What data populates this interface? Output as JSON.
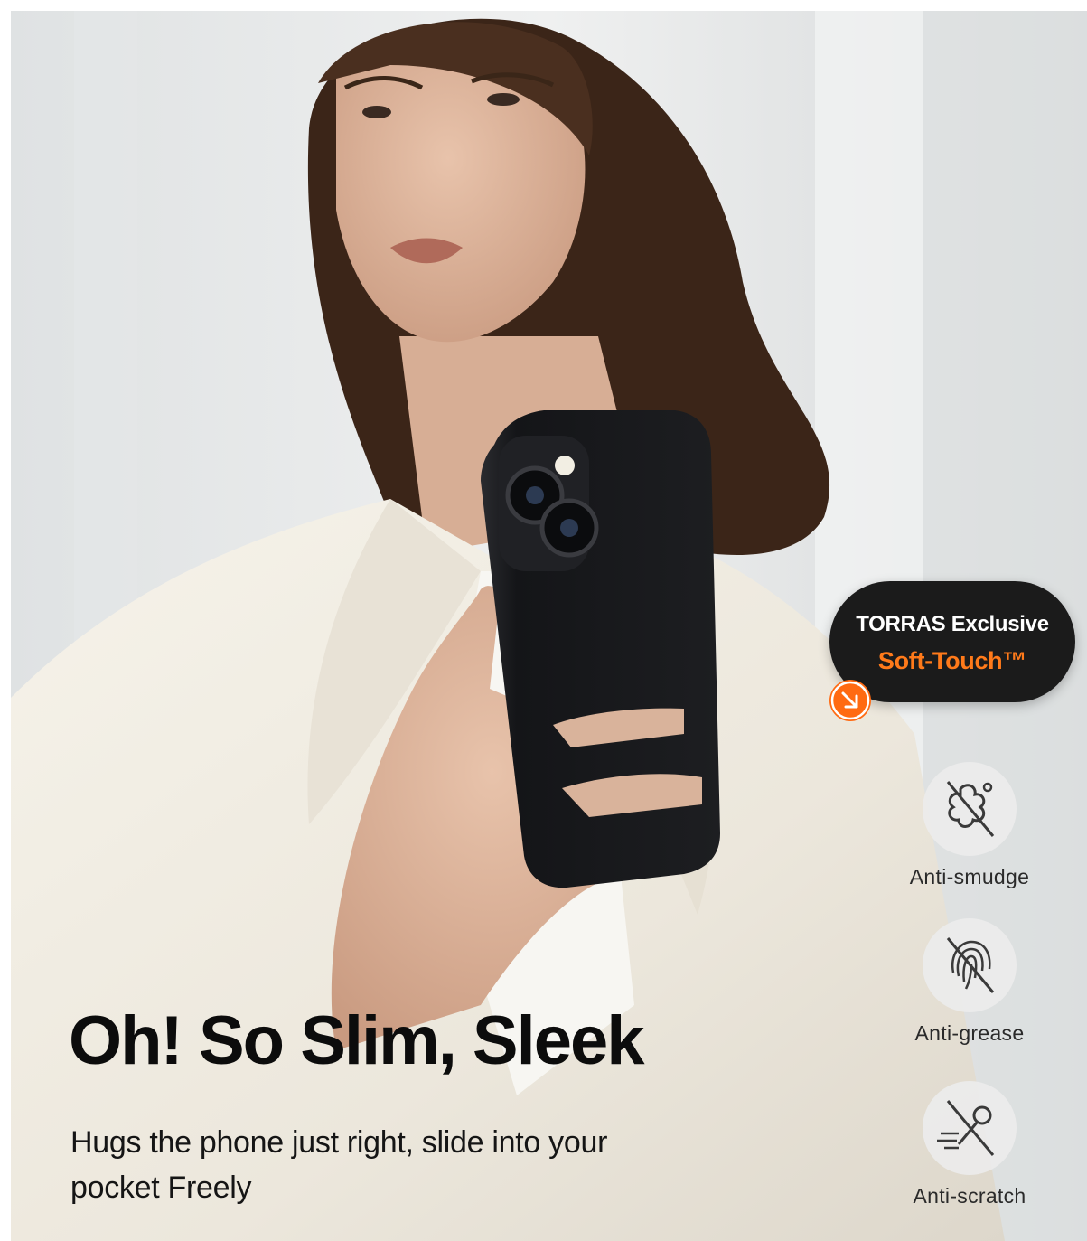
{
  "headline": "Oh! So Slim, Sleek",
  "subheadline": "Hugs the phone just right, slide into your pocket Freely",
  "badge": {
    "line1": "TORRAS Exclusive",
    "line2": "Soft-Touch™",
    "accent_color": "#ff6a12",
    "arrow_icon": "arrow-down-right-icon"
  },
  "features": [
    {
      "label": "Anti-smudge",
      "icon": "no-smudge-icon"
    },
    {
      "label": "Anti-grease",
      "icon": "no-fingerprint-icon"
    },
    {
      "label": "Anti-scratch",
      "icon": "no-scratch-icon"
    }
  ],
  "colors": {
    "case": "#16171a",
    "blazer": "#f1ede3",
    "hair": "#3b2518"
  }
}
